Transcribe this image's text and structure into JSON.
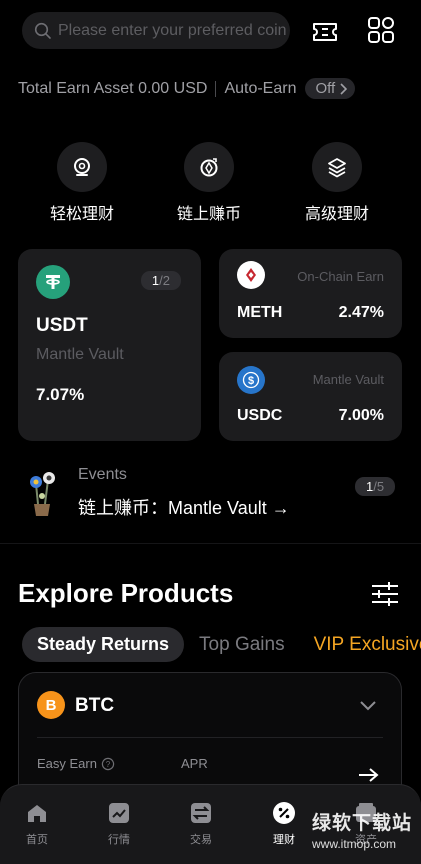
{
  "search": {
    "placeholder": "Please enter your preferred coin"
  },
  "earn": {
    "total_label": "Total Earn Asset 0.00 USD",
    "auto_label": "Auto-Earn",
    "auto_state": "Off"
  },
  "quick_actions": [
    {
      "label": "轻松理财",
      "icon": "circle-coin-icon"
    },
    {
      "label": "链上赚币",
      "icon": "chain-coin-icon"
    },
    {
      "label": "高级理财",
      "icon": "layers-icon"
    }
  ],
  "cards": {
    "featured": {
      "coin": "USDT",
      "subtitle": "Mantle Vault",
      "apr": "7.07%",
      "page_current": "1",
      "page_total": "/2"
    },
    "meth": {
      "coin": "METH",
      "tag": "On-Chain Earn",
      "apr": "2.47%"
    },
    "usdc": {
      "coin": "USDC",
      "tag": "Mantle Vault",
      "apr": "7.00%"
    }
  },
  "events": {
    "label": "Events",
    "title": "链上赚币：Mantle Vault →",
    "page_current": "1",
    "page_total": "/5"
  },
  "explore": {
    "title": "Explore Products",
    "tabs": [
      "Steady Returns",
      "Top Gains",
      "VIP Exclusive"
    ],
    "active_tab": "Steady Returns"
  },
  "product": {
    "coin": "BTC",
    "col1": "Easy Earn",
    "col2": "APR"
  },
  "nav": [
    {
      "label": "首页",
      "icon": "home-icon"
    },
    {
      "label": "行情",
      "icon": "chart-icon"
    },
    {
      "label": "交易",
      "icon": "trade-icon"
    },
    {
      "label": "理财",
      "icon": "percent-icon",
      "active": true
    },
    {
      "label": "资产",
      "icon": "wallet-icon"
    }
  ],
  "watermark": {
    "text": "绿软下载站",
    "url": "www.itmop.com"
  },
  "colors": {
    "accent": "#f5a623",
    "usdt": "#26a17b",
    "usdc": "#2775ca",
    "btc": "#f7931a",
    "meth": "#ffffff"
  }
}
